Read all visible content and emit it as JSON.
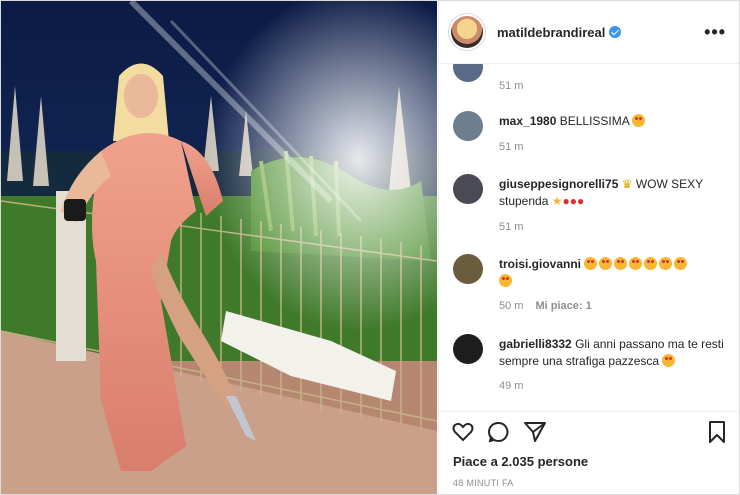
{
  "post": {
    "username": "matildebrandireal",
    "more_label": "•••"
  },
  "comments": [
    {
      "user": "",
      "text": "",
      "time": "51 m",
      "likes": ""
    },
    {
      "user": "max_1980",
      "text": "BELLISSIMA",
      "time": "51 m",
      "likes": ""
    },
    {
      "user": "giuseppesignorelli75",
      "text": "WOW SEXY stupenda",
      "time": "51 m",
      "likes": ""
    },
    {
      "user": "troisi.giovanni",
      "text": "",
      "time": "50 m",
      "likes": "Mi piace: 1"
    },
    {
      "user": "gabrielli8332",
      "text": "Gli anni passano ma te resti sempre una strafiga pazzesca",
      "time": "49 m",
      "likes": ""
    }
  ],
  "footer": {
    "likes_text": "Piace a 2.035 persone",
    "posted_time": "48 MINUTI FA"
  },
  "icons": {
    "like": "heart-icon",
    "comment": "comment-icon",
    "share": "share-icon",
    "save": "bookmark-icon"
  },
  "colors": {
    "verified": "#3897f0",
    "meta": "#8e8e8e",
    "text": "#262626"
  }
}
